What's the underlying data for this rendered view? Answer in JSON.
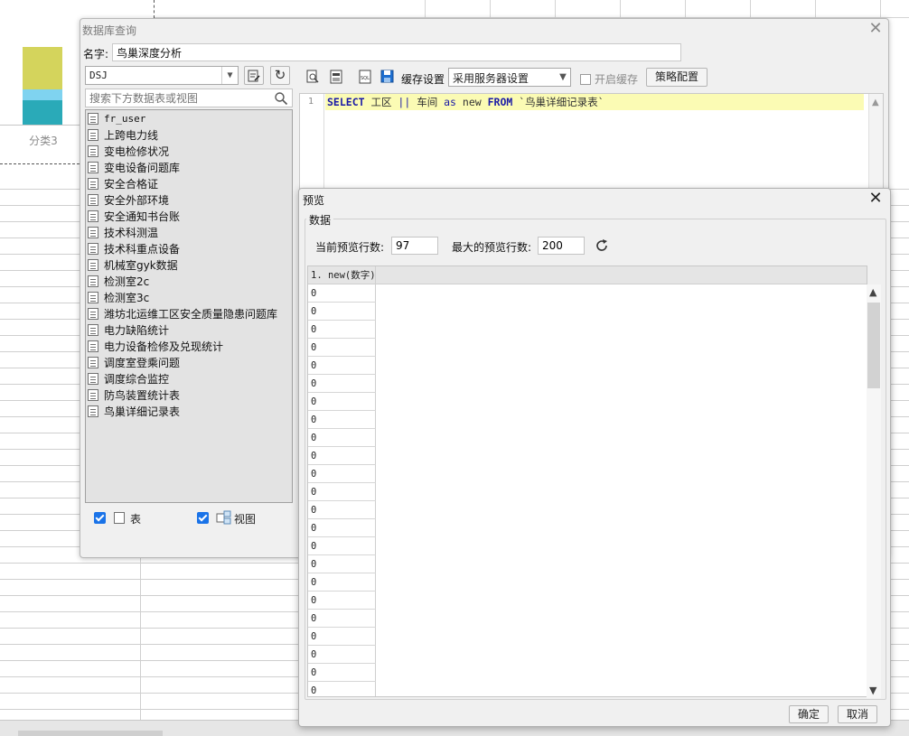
{
  "background": {
    "chart_category": "分类3",
    "colors": {
      "yellow": "#d4d45c",
      "blue": "#7fd3f0",
      "teal": "#2aaab8"
    }
  },
  "dialog": {
    "title": "数据库查询",
    "name_label": "名字:",
    "name_value": "鸟巢深度分析",
    "datasource": "DSJ",
    "search_placeholder": "搜索下方数据表或视图",
    "tables": [
      "fr_user",
      "上跨电力线",
      "变电检修状况",
      "变电设备问题库",
      "安全合格证",
      "安全外部环境",
      "安全通知书台账",
      "技术科测温",
      "技术科重点设备",
      "机械室gyk数据",
      "检测室2c",
      "检测室3c",
      "潍坊北运维工区安全质量隐患问题库",
      "电力缺陷统计",
      "电力设备检修及兑现统计",
      "调度室登乘问题",
      "调度综合监控",
      "防鸟装置统计表",
      "鸟巢详细记录表"
    ],
    "filter_table_label": "表",
    "filter_view_label": "视图",
    "cache_label": "缓存设置",
    "cache_option": "采用服务器设置",
    "enable_cache_label": "开启缓存",
    "strategy_button": "策略配置",
    "sql": {
      "line_number": "1",
      "kw_select": "SELECT",
      "col1": " 工区 ",
      "op": "||",
      "col2": " 车间 ",
      "kw_as": "as",
      "alias": " new ",
      "kw_from": "FROM",
      "table": " `鸟巢详细记录表`"
    }
  },
  "preview": {
    "title": "预览",
    "group_label": "数据",
    "current_rows_label": "当前预览行数:",
    "current_rows_value": "97",
    "max_rows_label": "最大的预览行数:",
    "max_rows_value": "200",
    "column_header": "1. new(数字)",
    "rows": [
      "0",
      "0",
      "0",
      "0",
      "0",
      "0",
      "0",
      "0",
      "0",
      "0",
      "0",
      "0",
      "0",
      "0",
      "0",
      "0",
      "0",
      "0",
      "0",
      "0",
      "0",
      "0",
      "0"
    ],
    "ok_label": "确定",
    "cancel_label": "取消"
  }
}
